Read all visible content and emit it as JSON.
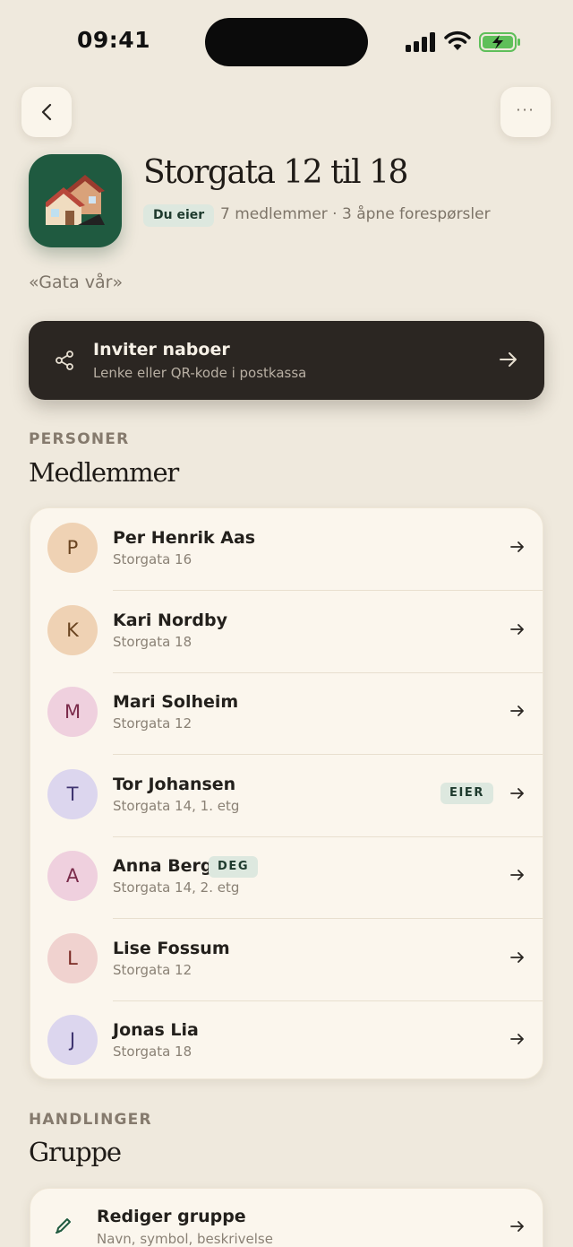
{
  "status_bar": {
    "time": "09:41"
  },
  "header": {
    "more_label": "···"
  },
  "group": {
    "title": "Storgata 12 til 18",
    "owner_chip": "Du eier",
    "meta": "7 medlemmer · 3 åpne forespørsler",
    "motto": "«Gata vår»",
    "icon": "houses-emoji",
    "icon_glyph": "🏘️"
  },
  "invite": {
    "title": "Inviter naboer",
    "subtitle": "Lenke eller QR-kode i postkassa"
  },
  "members_section": {
    "eyebrow": "PERSONER",
    "title": "Medlemmer",
    "members": [
      {
        "initial": "P",
        "name": "Per Henrik Aas",
        "address": "Storgata 16",
        "avatar_bg": "#efd2b4",
        "avatar_fg": "#6a4420"
      },
      {
        "initial": "K",
        "name": "Kari Nordby",
        "address": "Storgata 18",
        "avatar_bg": "#efd2b4",
        "avatar_fg": "#6a4420"
      },
      {
        "initial": "M",
        "name": "Mari Solheim",
        "address": "Storgata 12",
        "avatar_bg": "#efd0de",
        "avatar_fg": "#7a2a4a"
      },
      {
        "initial": "T",
        "name": "Tor Johansen",
        "address": "Storgata 14, 1. etg",
        "badge": "EIER",
        "avatar_bg": "#dcd6ee",
        "avatar_fg": "#3f3470"
      },
      {
        "initial": "A",
        "name": "Anna Berg",
        "address": "Storgata 14, 2. etg",
        "badge": "DEG",
        "avatar_bg": "#efd0de",
        "avatar_fg": "#7a2a4a"
      },
      {
        "initial": "L",
        "name": "Lise Fossum",
        "address": "Storgata 12",
        "avatar_bg": "#f0d2cf",
        "avatar_fg": "#7a2a24"
      },
      {
        "initial": "J",
        "name": "Jonas Lia",
        "address": "Storgata 18",
        "avatar_bg": "#dcd6ee",
        "avatar_fg": "#3f3470"
      }
    ]
  },
  "actions_section": {
    "eyebrow": "HANDLINGER",
    "title": "Gruppe",
    "items": [
      {
        "title": "Rediger gruppe",
        "subtitle": "Navn, symbol, beskrivelse"
      }
    ]
  },
  "colors": {
    "background": "#efe9dd",
    "accent_green": "#1f5a40",
    "dark_card": "#2b2622"
  }
}
